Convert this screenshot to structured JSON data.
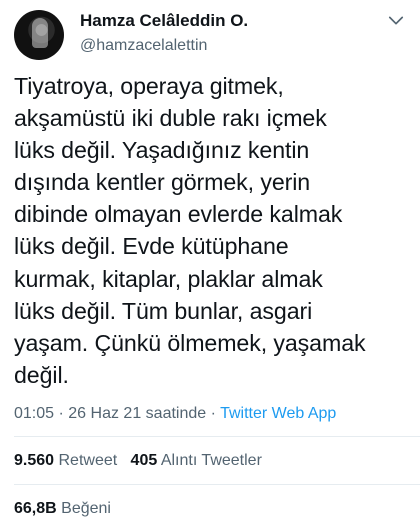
{
  "author": {
    "name": "Hamza Celâleddin O.",
    "handle": "@hamzacelalettin"
  },
  "tweet": {
    "text": "Tiyatroya, operaya gitmek,\nakşamüstü iki duble rakı içmek\nlüks değil. Yaşadığınız kentin\ndışında kentler görmek, yerin\ndibinde olmayan evlerde kalmak\nlüks değil. Evde kütüphane\nkurmak, kitaplar, plaklar almak\nlüks değil. Tüm bunlar, asgari\nyaşam. Çünkü ölmemek, yaşamak\ndeğil."
  },
  "meta": {
    "time": "01:05",
    "separator": "·",
    "date": "26 Haz 21 saatinde",
    "app": "Twitter Web App"
  },
  "stats": {
    "retweets_count": "9.560",
    "retweets_label": "Retweet",
    "quotes_count": "405",
    "quotes_label": "Alıntı Tweetler",
    "likes_count": "66,8B",
    "likes_label": "Beğeni"
  },
  "icons": {
    "menu": "chevron-down-icon"
  }
}
